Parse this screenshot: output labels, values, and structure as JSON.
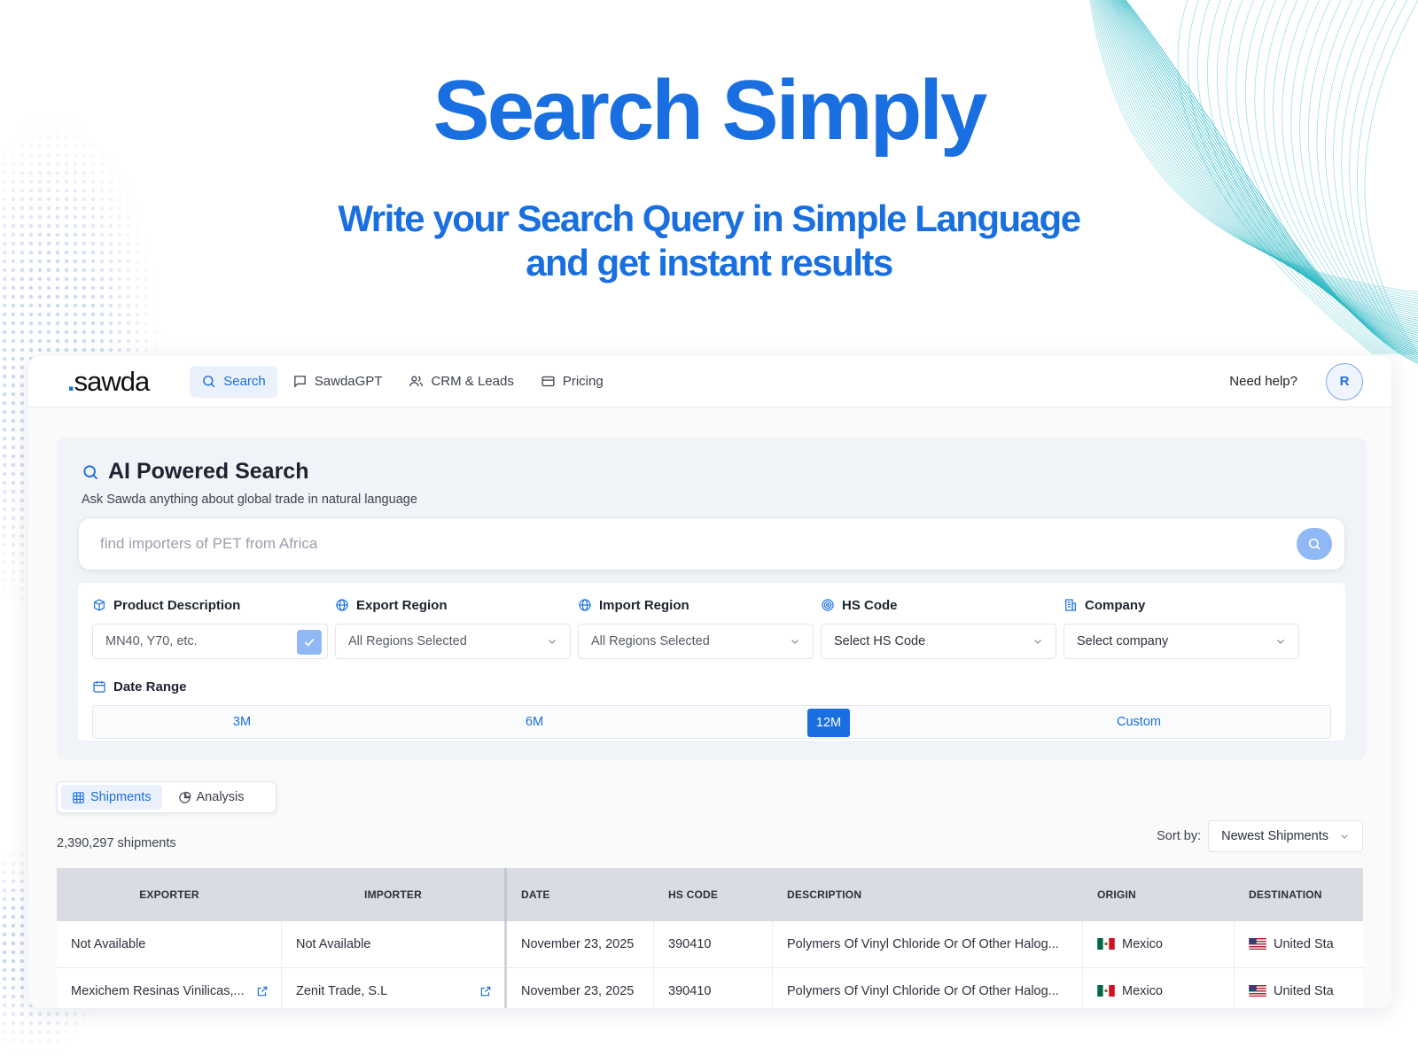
{
  "hero": {
    "title": "Search Simply",
    "subtitle_line1": "Write your Search Query in Simple Language",
    "subtitle_line2": "and get instant results"
  },
  "colors": {
    "brand": "#1a6fe0",
    "brand_light": "#8fb8f4",
    "wave": "#2bb8c4"
  },
  "nav": {
    "logo": "sawda",
    "items": [
      {
        "label": "Search",
        "icon": "search-icon",
        "active": true
      },
      {
        "label": "SawdaGPT",
        "icon": "chat-icon",
        "active": false
      },
      {
        "label": "CRM & Leads",
        "icon": "users-icon",
        "active": false
      },
      {
        "label": "Pricing",
        "icon": "card-icon",
        "active": false
      }
    ],
    "help": "Need help?",
    "avatar": "R"
  },
  "search": {
    "title": "AI Powered Search",
    "subtitle": "Ask Sawda anything about global trade in natural language",
    "placeholder": "find importers of PET from Africa"
  },
  "filters": {
    "product": {
      "label": "Product Description",
      "placeholder": "MN40, Y70, etc."
    },
    "export_region": {
      "label": "Export Region",
      "value": "All Regions Selected"
    },
    "import_region": {
      "label": "Import Region",
      "value": "All Regions Selected"
    },
    "hs_code": {
      "label": "HS Code",
      "value": "Select HS Code"
    },
    "company": {
      "label": "Company",
      "value": "Select company"
    },
    "date_range": {
      "label": "Date Range",
      "options": [
        "3M",
        "6M",
        "12M",
        "Custom"
      ],
      "selected": "12M"
    }
  },
  "tabs": [
    {
      "label": "Shipments",
      "icon": "grid-icon",
      "active": true
    },
    {
      "label": "Analysis",
      "icon": "pie-icon",
      "active": false
    }
  ],
  "results": {
    "count": "2,390,297 shipments",
    "sort_label": "Sort by:",
    "sort_value": "Newest Shipments"
  },
  "table": {
    "columns": [
      "EXPORTER",
      "IMPORTER",
      "DATE",
      "HS CODE",
      "DESCRIPTION",
      "ORIGIN",
      "DESTINATION"
    ],
    "rows": [
      {
        "exporter": "Not Available",
        "importer": "Not Available",
        "date": "November 23, 2025",
        "hs_code": "390410",
        "description": "Polymers Of Vinyl Chloride Or Of Other Halog...",
        "origin": "Mexico",
        "destination": "United Sta"
      },
      {
        "exporter": "Mexichem Resinas Vinilicas,...",
        "importer": "Zenit Trade, S.L",
        "date": "November 23, 2025",
        "hs_code": "390410",
        "description": "Polymers Of Vinyl Chloride Or Of Other Halog...",
        "origin": "Mexico",
        "destination": "United Sta"
      }
    ]
  }
}
